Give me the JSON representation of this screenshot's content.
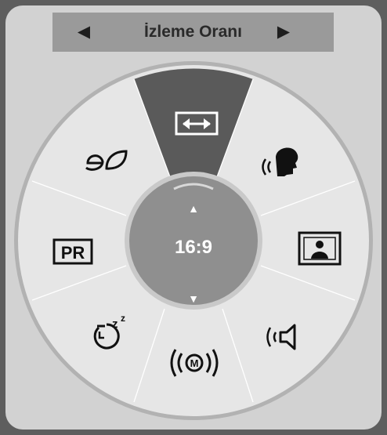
{
  "header": {
    "title": "İzleme Oranı",
    "prev_arrow": "◀",
    "next_arrow": "▶"
  },
  "center": {
    "value": "16:9",
    "up_arrow": "▲",
    "down_arrow": "▼"
  },
  "menu_items": [
    {
      "icon": "aspect-ratio-icon",
      "selected": true
    },
    {
      "icon": "voice-clarity-icon",
      "selected": false
    },
    {
      "icon": "picture-mode-icon",
      "selected": false
    },
    {
      "icon": "sound-mode-icon",
      "selected": false
    },
    {
      "icon": "mute-icon",
      "selected": false
    },
    {
      "icon": "sleep-timer-icon",
      "selected": false
    },
    {
      "icon": "program-list-icon",
      "selected": false
    },
    {
      "icon": "energy-saving-icon",
      "selected": false
    }
  ],
  "icon_labels": {
    "program": "PR",
    "mute": "M",
    "sleep_z1": "z",
    "sleep_z2": "z"
  },
  "colors": {
    "background": "#5e5e5e",
    "panel": "#d2d2d2",
    "header_bar": "#9a9a9a",
    "selected_sector": "#5a5a5a",
    "center_disc": "#8f8f8f"
  }
}
